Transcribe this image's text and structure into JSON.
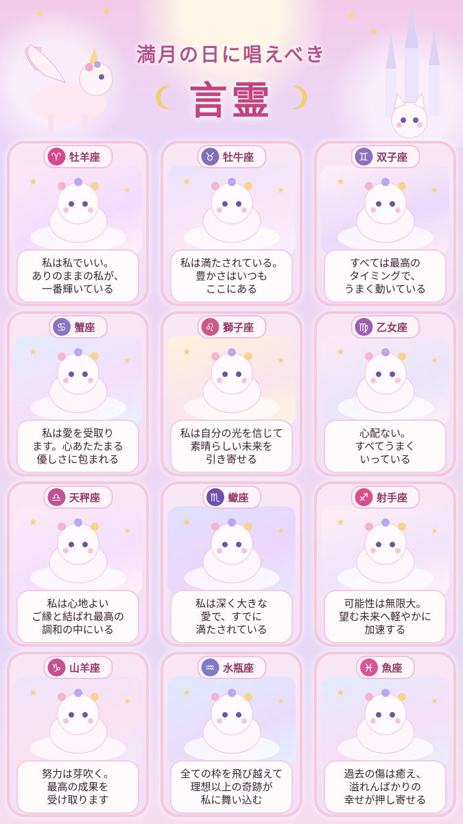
{
  "header": {
    "title_line1": "満月の日に唱えべき",
    "title_line2": "言霊"
  },
  "colors": {
    "title": "#c2457f",
    "badge_fire": "#d9468c",
    "badge_earth": "#8b78c8",
    "badge_air": "#9a6cc4",
    "badge_water": "#c05fa8"
  },
  "cards": [
    {
      "name": "牡羊座",
      "symbol": "♈",
      "color": "#d9468c",
      "lines": [
        "私は私でいい。",
        "ありのままの私が、",
        "一番輝いている"
      ],
      "icon": "ram-icon"
    },
    {
      "name": "牡牛座",
      "symbol": "♉",
      "color": "#7f6fb8",
      "lines": [
        "私は満たされている。",
        "豊かさはいつも",
        "ここにある"
      ],
      "icon": "bull-icon"
    },
    {
      "name": "双子座",
      "symbol": "♊",
      "color": "#8c6fbf",
      "lines": [
        "すべては最高の",
        "タイミングで、",
        "うまく動いている"
      ],
      "icon": "twins-icon"
    },
    {
      "name": "蟹座",
      "symbol": "♋",
      "color": "#8b74c4",
      "lines": [
        "私は愛を受取り",
        "ます。心あたたまる",
        "優しさに包まれる"
      ],
      "icon": "crab-icon"
    },
    {
      "name": "獅子座",
      "symbol": "♌",
      "color": "#c95a8a",
      "lines": [
        "私は自分の光を信じて",
        "素晴らしい未来を",
        "引き寄せる"
      ],
      "icon": "lion-icon"
    },
    {
      "name": "乙女座",
      "symbol": "♍",
      "color": "#9c5cb4",
      "lines": [
        "心配ない。",
        "すべてうまく",
        "いっている"
      ],
      "icon": "maiden-icon"
    },
    {
      "name": "天秤座",
      "symbol": "♎",
      "color": "#c25298",
      "lines": [
        "私は心地よい",
        "ご縁と結ばれ最高の",
        "調和の中にいる"
      ],
      "icon": "scales-icon"
    },
    {
      "name": "蠍座",
      "symbol": "♏",
      "color": "#6d4fb0",
      "lines": [
        "私は深く大きな",
        "愛で、すでに",
        "満たされている"
      ],
      "icon": "scorpion-icon"
    },
    {
      "name": "射手座",
      "symbol": "♐",
      "color": "#d94f8c",
      "lines": [
        "可能性は無限大。",
        "望む未来へ軽やかに",
        "加速する"
      ],
      "icon": "archer-icon"
    },
    {
      "name": "山羊座",
      "symbol": "♑",
      "color": "#c4508f",
      "lines": [
        "努力は芽吹く。",
        "最高の成果を",
        "受け取ります"
      ],
      "icon": "goat-icon"
    },
    {
      "name": "水瓶座",
      "symbol": "♒",
      "color": "#7d7acb",
      "lines": [
        "全ての枠を飛び越えて",
        "理想以上の奇跡が",
        "私に舞い込む"
      ],
      "icon": "water-bearer-icon"
    },
    {
      "name": "魚座",
      "symbol": "♓",
      "color": "#d75595",
      "lines": [
        "過去の傷は癒え、",
        "溢れんばかりの",
        "幸せが押し寄せる"
      ],
      "icon": "fish-icon"
    }
  ]
}
